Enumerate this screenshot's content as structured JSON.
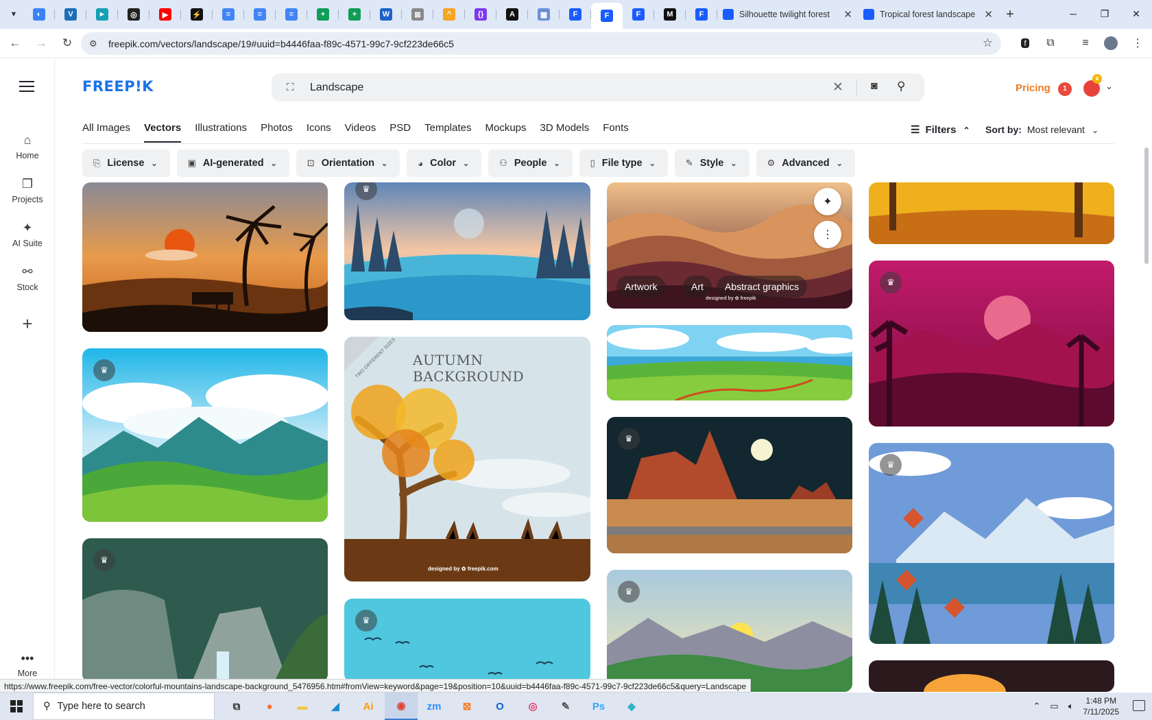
{
  "browser": {
    "tabs": [
      {
        "icon": "globe-icon",
        "color": "#3b82f6",
        "letter": "◐"
      },
      {
        "icon": "vpn-icon",
        "color": "#1d6fb8",
        "letter": "V"
      },
      {
        "icon": "arrow-icon",
        "color": "#15a0b5",
        "letter": "►"
      },
      {
        "icon": "openai-icon",
        "color": "#222",
        "letter": "◎"
      },
      {
        "icon": "youtube-icon",
        "color": "#ff0000",
        "letter": "▶"
      },
      {
        "icon": "bolt-icon",
        "color": "#111",
        "letter": "⚡"
      },
      {
        "icon": "docs-icon",
        "color": "#4285f4",
        "letter": "≡"
      },
      {
        "icon": "docs-icon",
        "color": "#4285f4",
        "letter": "≡"
      },
      {
        "icon": "docs-icon",
        "color": "#4285f4",
        "letter": "≡"
      },
      {
        "icon": "sheets-icon",
        "color": "#0f9d58",
        "letter": "+"
      },
      {
        "icon": "sheets-icon",
        "color": "#0f9d58",
        "letter": "+"
      },
      {
        "icon": "word-icon",
        "color": "#1e63c6",
        "letter": "W"
      },
      {
        "icon": "box-icon",
        "color": "#888",
        "letter": "⊠"
      },
      {
        "icon": "chevron-icon",
        "color": "#f5a623",
        "letter": "^"
      },
      {
        "icon": "code-icon",
        "color": "#7c3aed",
        "letter": "{}"
      },
      {
        "icon": "a-icon",
        "color": "#111",
        "letter": "A"
      },
      {
        "icon": "grid-icon",
        "color": "#6b8fd6",
        "letter": "▦"
      },
      {
        "icon": "freepik-icon",
        "color": "#1a5cff",
        "letter": "F"
      },
      {
        "icon": "freepik-icon",
        "color": "#1a5cff",
        "letter": "F",
        "active": true
      },
      {
        "icon": "freepik-icon",
        "color": "#1a5cff",
        "letter": "F"
      },
      {
        "icon": "m-icon",
        "color": "#111",
        "letter": "M"
      },
      {
        "icon": "freepik-icon",
        "color": "#1a5cff",
        "letter": "F"
      }
    ],
    "full_tabs": [
      {
        "title": "Silhouette twilight forest"
      },
      {
        "title": "Tropical forest landscape"
      }
    ],
    "url": "freepik.com/vectors/landscape/19#uuid=b4446faa-f89c-4571-99c7-9cf223de66c5",
    "status_url": "https://www.freepik.com/free-vector/colorful-mountains-landscape-background_5476956.htm#fromView=keyword&page=19&position=10&uuid=b4446faa-f89c-4571-99c7-9cf223de66c5&query=Landscape"
  },
  "sidebar": {
    "items": [
      {
        "label": "Home",
        "icon": "home-icon"
      },
      {
        "label": "Projects",
        "icon": "projects-icon"
      },
      {
        "label": "AI Suite",
        "icon": "sparkle-icon"
      },
      {
        "label": "Stock",
        "icon": "stock-icon"
      }
    ],
    "more_label": "More"
  },
  "header": {
    "logo": "FREEP!K",
    "search_query": "Landscape",
    "pricing_label": "Pricing",
    "notification_count": "1"
  },
  "categories": [
    {
      "label": "All Images"
    },
    {
      "label": "Vectors",
      "active": true
    },
    {
      "label": "Illustrations"
    },
    {
      "label": "Photos"
    },
    {
      "label": "Icons"
    },
    {
      "label": "Videos"
    },
    {
      "label": "PSD"
    },
    {
      "label": "Templates"
    },
    {
      "label": "Mockups"
    },
    {
      "label": "3D Models"
    },
    {
      "label": "Fonts"
    }
  ],
  "toolbar": {
    "filters_label": "Filters",
    "sort_label": "Sort by:",
    "sort_value": "Most relevant"
  },
  "filter_chips": [
    {
      "label": "License",
      "icon": "license-icon"
    },
    {
      "label": "AI-generated",
      "icon": "ai-icon"
    },
    {
      "label": "Orientation",
      "icon": "orientation-icon"
    },
    {
      "label": "Color",
      "icon": "color-icon"
    },
    {
      "label": "People",
      "icon": "people-icon"
    },
    {
      "label": "File type",
      "icon": "file-icon"
    },
    {
      "label": "Style",
      "icon": "style-icon"
    },
    {
      "label": "Advanced",
      "icon": "gear-icon"
    }
  ],
  "hover_card": {
    "tags": [
      "Artwork",
      "Art",
      "Abstract graphics"
    ],
    "watermark": "designed by ✿ freepik"
  },
  "autumn_card": {
    "title": "AUTUMN BACKGROUND",
    "ribbon": "TWO DIFFERENT SIZES",
    "watermark": "designed by ✿ freepik.com"
  },
  "taskbar": {
    "search_placeholder": "Type here to search",
    "time": "1:48 PM",
    "date": "7/11/2025",
    "apps": [
      {
        "icon": "task-view-icon",
        "glyph": "⧉",
        "color": "#333"
      },
      {
        "icon": "firefox-icon",
        "glyph": "●",
        "color": "#ff7139"
      },
      {
        "icon": "file-explorer-icon",
        "glyph": "▬",
        "color": "#f4c542"
      },
      {
        "icon": "vscode-icon",
        "glyph": "◢",
        "color": "#1f8ad2"
      },
      {
        "icon": "illustrator-icon",
        "glyph": "Ai",
        "color": "#ff9a00"
      },
      {
        "icon": "chrome-icon",
        "glyph": "◉",
        "color": "#db4437",
        "active": true
      },
      {
        "icon": "zoom-icon",
        "glyph": "zm",
        "color": "#2d8cff"
      },
      {
        "icon": "xampp-icon",
        "glyph": "⊠",
        "color": "#fb7a24"
      },
      {
        "icon": "outlook-icon",
        "glyph": "O",
        "color": "#0a64d8"
      },
      {
        "icon": "creative-cloud-icon",
        "glyph": "◎",
        "color": "#e03a6b"
      },
      {
        "icon": "pen-icon",
        "glyph": "✎",
        "color": "#555"
      },
      {
        "icon": "photoshop-icon",
        "glyph": "Ps",
        "color": "#31a8ff"
      },
      {
        "icon": "vpn-app-icon",
        "glyph": "◆",
        "color": "#2fb3c9"
      }
    ]
  }
}
